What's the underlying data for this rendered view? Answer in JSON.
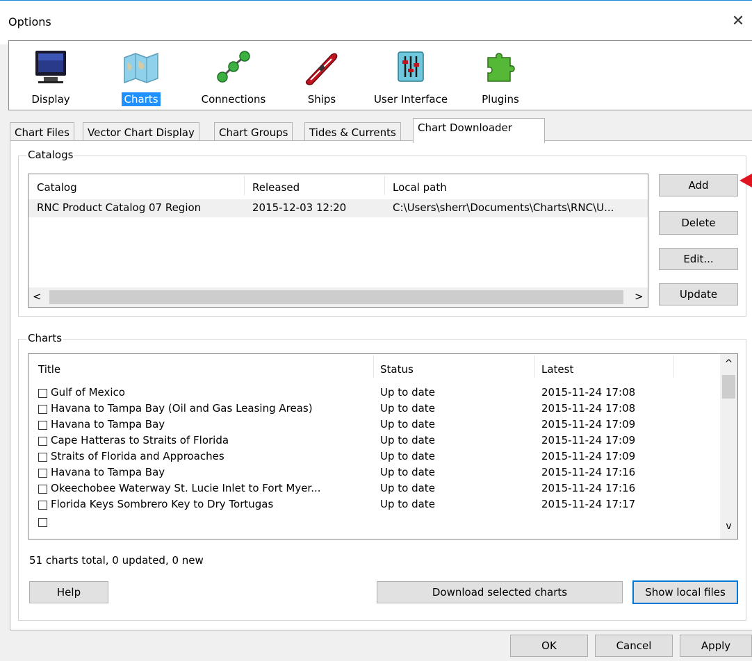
{
  "window": {
    "title": "Options",
    "close_symbol": "✕"
  },
  "toolbar": {
    "items": [
      {
        "label": "Display",
        "icon": "display-monitor-icon"
      },
      {
        "label": "Charts",
        "icon": "charts-map-icon",
        "selected": true
      },
      {
        "label": "Connections",
        "icon": "connections-nodes-icon"
      },
      {
        "label": "Ships",
        "icon": "ship-boat-icon"
      },
      {
        "label": "User Interface",
        "icon": "sliders-icon"
      },
      {
        "label": "Plugins",
        "icon": "puzzle-plugin-icon"
      }
    ]
  },
  "tabs": [
    {
      "label": "Chart Files"
    },
    {
      "label": "Vector Chart Display"
    },
    {
      "label": "Chart Groups"
    },
    {
      "label": "Tides & Currents"
    },
    {
      "label": "Chart Downloader",
      "active": true
    }
  ],
  "catalogs": {
    "group_label": "Catalogs",
    "columns": [
      "Catalog",
      "Released",
      "Local path"
    ],
    "rows": [
      {
        "catalog": "RNC Product Catalog 07 Region",
        "released": "2015-12-03 12:20",
        "path": "C:\\Users\\sherr\\Documents\\Charts\\RNC\\U..."
      }
    ],
    "scroll_left": "<",
    "scroll_right": ">",
    "buttons": {
      "add": "Add",
      "delete": "Delete",
      "edit": "Edit...",
      "update": "Update"
    }
  },
  "charts": {
    "group_label": "Charts",
    "columns": [
      "Title",
      "Status",
      "Latest"
    ],
    "rows": [
      {
        "title": "Gulf of Mexico",
        "status": "Up to date",
        "latest": "2015-11-24 17:08"
      },
      {
        "title": "Havana to Tampa Bay (Oil and Gas Leasing Areas)",
        "status": "Up to date",
        "latest": "2015-11-24 17:08"
      },
      {
        "title": "Havana to Tampa Bay",
        "status": "Up to date",
        "latest": "2015-11-24 17:09"
      },
      {
        "title": "Cape Hatteras to Straits of Florida",
        "status": "Up to date",
        "latest": "2015-11-24 17:09"
      },
      {
        "title": "Straits of Florida and Approaches",
        "status": "Up to date",
        "latest": "2015-11-24 17:09"
      },
      {
        "title": "Havana to Tampa Bay",
        "status": "Up to date",
        "latest": "2015-11-24 17:16"
      },
      {
        "title": "Okeechobee Waterway St. Lucie Inlet to Fort Myer...",
        "status": "Up to date",
        "latest": "2015-11-24 17:16"
      },
      {
        "title": "Florida Keys Sombrero Key to Dry Tortugas",
        "status": "Up to date",
        "latest": "2015-11-24 17:17"
      }
    ],
    "scroll_up": "^",
    "scroll_down": "v",
    "summary": "51 charts total, 0 updated, 0 new",
    "buttons": {
      "help": "Help",
      "download": "Download selected charts",
      "show_local": "Show local files"
    }
  },
  "footer": {
    "ok": "OK",
    "cancel": "Cancel",
    "apply": "Apply"
  },
  "colors": {
    "selection": "#1e90ff",
    "focus_border": "#0078d7",
    "annotation_arrow": "#e0141e"
  }
}
